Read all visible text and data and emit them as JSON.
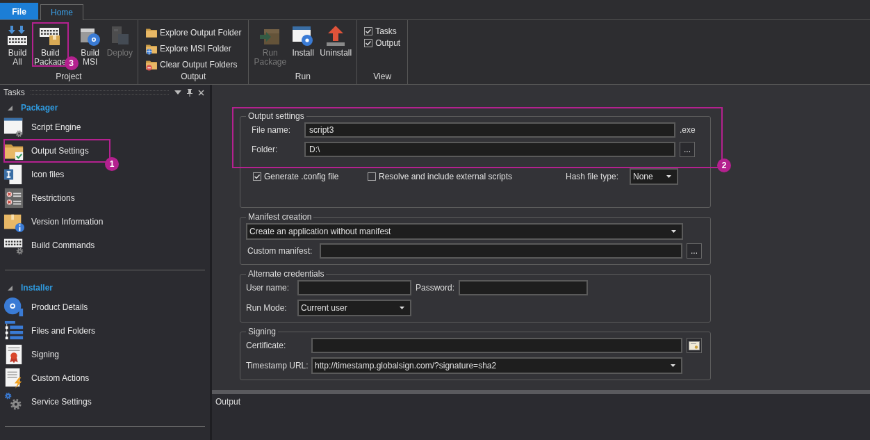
{
  "ribbon": {
    "tabs": [
      {
        "label": "File",
        "kind": "file",
        "selected": false
      },
      {
        "label": "Home",
        "kind": "tab",
        "selected": true
      }
    ],
    "groups": [
      {
        "label": "Project",
        "kind": "large",
        "items": [
          {
            "label": "Build All",
            "kind": "build-all",
            "disabled": false
          },
          {
            "label": "Build Package",
            "kind": "build-package",
            "disabled": false,
            "callout": "3"
          },
          {
            "label": "Build MSI",
            "kind": "build-msi",
            "disabled": false
          },
          {
            "label": "Deploy",
            "kind": "deploy",
            "disabled": true
          }
        ]
      },
      {
        "label": "Output",
        "kind": "small",
        "items": [
          {
            "label": "Explore Output Folder",
            "kind": "folder"
          },
          {
            "label": "Explore MSI Folder",
            "kind": "folder-globe"
          },
          {
            "label": "Clear Output Folders",
            "kind": "folder-remove"
          }
        ]
      },
      {
        "label": "Run",
        "kind": "large",
        "items": [
          {
            "label": "Run Package",
            "kind": "run-package",
            "disabled": true
          },
          {
            "label": "Install",
            "kind": "install",
            "disabled": false
          },
          {
            "label": "Uninstall",
            "kind": "uninstall",
            "disabled": false
          }
        ]
      },
      {
        "label": "View",
        "kind": "checks",
        "items": [
          {
            "label": "Tasks",
            "checked": true
          },
          {
            "label": "Output",
            "checked": true
          }
        ]
      }
    ]
  },
  "tasks_panel": {
    "title": "Tasks",
    "sections": [
      {
        "label": "Packager",
        "expanded": true,
        "items": [
          {
            "label": "Script Engine",
            "kind": "script-engine"
          },
          {
            "label": "Output Settings",
            "kind": "output-settings",
            "callout": "1"
          },
          {
            "label": "Icon files",
            "kind": "icon-files"
          },
          {
            "label": "Restrictions",
            "kind": "restrictions"
          },
          {
            "label": "Version Information",
            "kind": "version-info"
          },
          {
            "label": "Build Commands",
            "kind": "build-commands"
          }
        ]
      },
      {
        "label": "Installer",
        "expanded": true,
        "items": [
          {
            "label": "Product Details",
            "kind": "product-details"
          },
          {
            "label": "Files and Folders",
            "kind": "files-folders"
          },
          {
            "label": "Signing",
            "kind": "signing"
          },
          {
            "label": "Custom Actions",
            "kind": "custom-actions"
          },
          {
            "label": "Service Settings",
            "kind": "service-settings"
          }
        ]
      }
    ]
  },
  "output_settings": {
    "title": "Output settings",
    "callout": "2",
    "file_name": {
      "label": "File name:",
      "value": "script3",
      "suffix": ".exe"
    },
    "folder": {
      "label": "Folder:",
      "value": "D:\\",
      "button": "..."
    },
    "generate_config": {
      "label": "Generate .config file",
      "checked": true
    },
    "resolve_scripts": {
      "label": "Resolve and include external scripts",
      "checked": false
    },
    "hash_type": {
      "label": "Hash file type:",
      "value": "None"
    }
  },
  "manifest_creation": {
    "title": "Manifest creation",
    "mode": {
      "value": "Create an application without manifest"
    },
    "custom_manifest": {
      "label": "Custom manifest:",
      "button": "..."
    }
  },
  "alternate_credentials": {
    "title": "Alternate credentials",
    "user_name": {
      "label": "User name:"
    },
    "password": {
      "label": "Password:"
    },
    "run_mode": {
      "label": "Run Mode:",
      "value": "Current user"
    }
  },
  "signing": {
    "title": "Signing",
    "certificate": {
      "label": "Certificate:"
    },
    "timestamp_url": {
      "label": "Timestamp URL:",
      "value": "http://timestamp.globalsign.com/?signature=sha2"
    }
  },
  "output_panel": {
    "title": "Output"
  }
}
